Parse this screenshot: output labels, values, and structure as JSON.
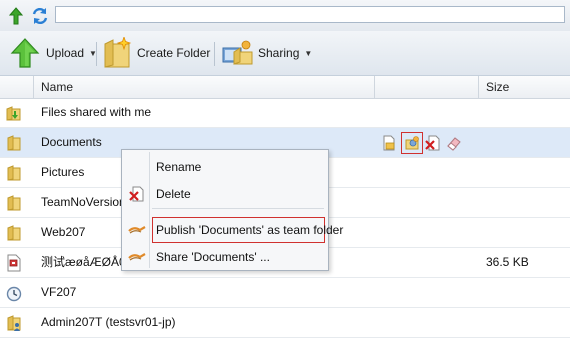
{
  "address_bar": {
    "value": "",
    "up_icon": "green-up-arrow-icon",
    "refresh_icon": "refresh-icon"
  },
  "toolbar": {
    "upload_label": "Upload",
    "create_folder_label": "Create Folder",
    "sharing_label": "Sharing"
  },
  "columns": {
    "name": "Name",
    "size": "Size"
  },
  "rows": [
    {
      "name": "Files shared with me",
      "size": "",
      "icon": "shared-folder-icon"
    },
    {
      "name": "Documents",
      "size": "",
      "icon": "folder-icon",
      "selected": true
    },
    {
      "name": "Pictures",
      "size": "",
      "icon": "folder-icon"
    },
    {
      "name": "TeamNoVersion",
      "size": "",
      "icon": "folder-icon"
    },
    {
      "name": "Web207",
      "size": "",
      "icon": "folder-icon"
    },
    {
      "name": "测试æøåÆØÅ001.zip",
      "size": "36.5 KB",
      "icon": "archive-file-icon"
    },
    {
      "name": "VF207",
      "size": "",
      "icon": "clock-folder-icon"
    },
    {
      "name": "Admin207T (testsvr01-jp)",
      "size": "",
      "icon": "user-folder-icon"
    }
  ],
  "context_menu": {
    "rename": "Rename",
    "delete": "Delete",
    "publish": "Publish 'Documents' as team folder",
    "share": "Share 'Documents' ..."
  },
  "colors": {
    "selection": "#dde9f8",
    "highlight_border": "#d0312f",
    "folder": "#e9c14a"
  }
}
